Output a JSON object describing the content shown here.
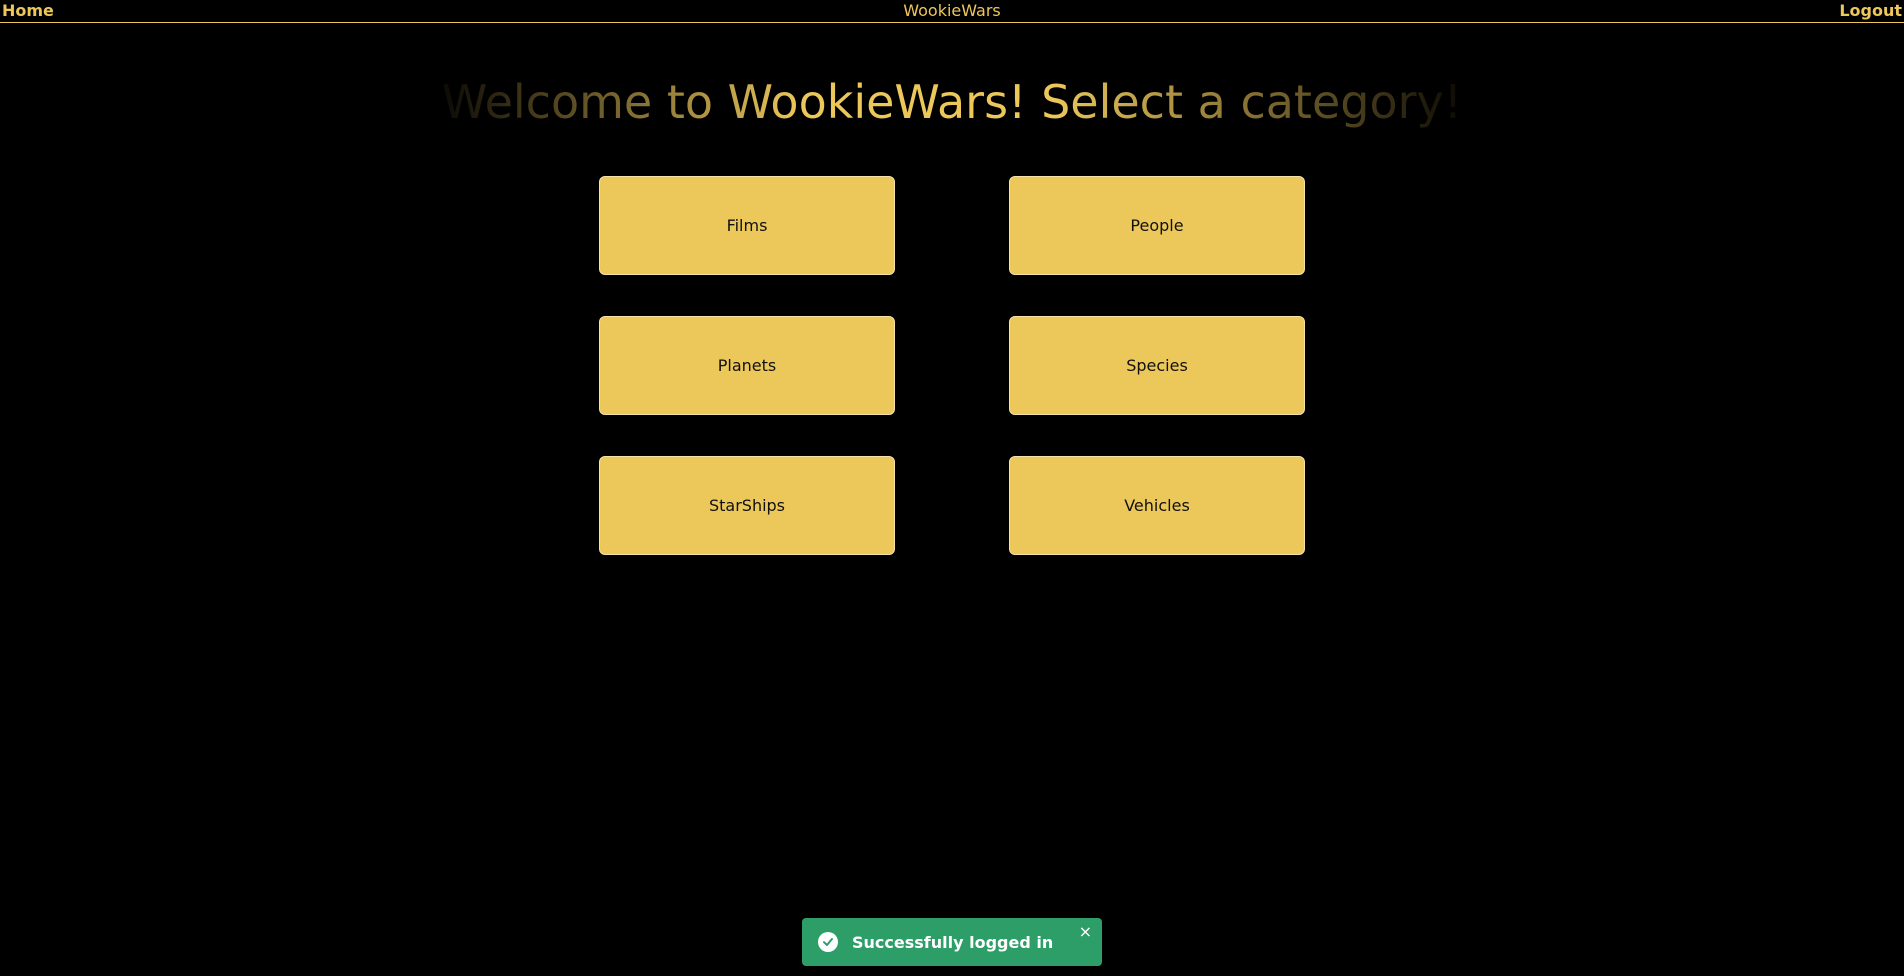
{
  "nav": {
    "home_label": "Home",
    "app_title": "WookieWars",
    "logout_label": "Logout"
  },
  "main": {
    "welcome_text": "Welcome to WookieWars! Select a category!",
    "categories": [
      {
        "label": "Films"
      },
      {
        "label": "People"
      },
      {
        "label": "Planets"
      },
      {
        "label": "Species"
      },
      {
        "label": "StarShips"
      },
      {
        "label": "Vehicles"
      }
    ]
  },
  "toast": {
    "message": "Successfully logged in",
    "icon": "check-circle-icon",
    "close_icon": "close-icon",
    "close_glyph": "×"
  },
  "colors": {
    "background": "#000000",
    "accent": "#ECC75A",
    "toast_bg": "#2E9E68"
  }
}
